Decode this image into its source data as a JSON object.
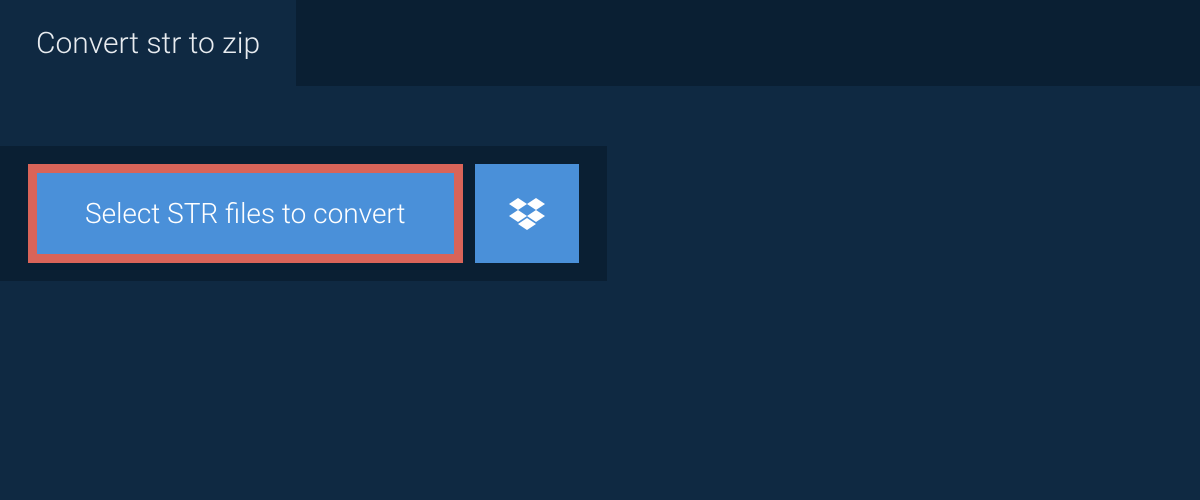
{
  "tab": {
    "label": "Convert str to zip"
  },
  "actions": {
    "select_files_label": "Select STR files to convert"
  }
}
